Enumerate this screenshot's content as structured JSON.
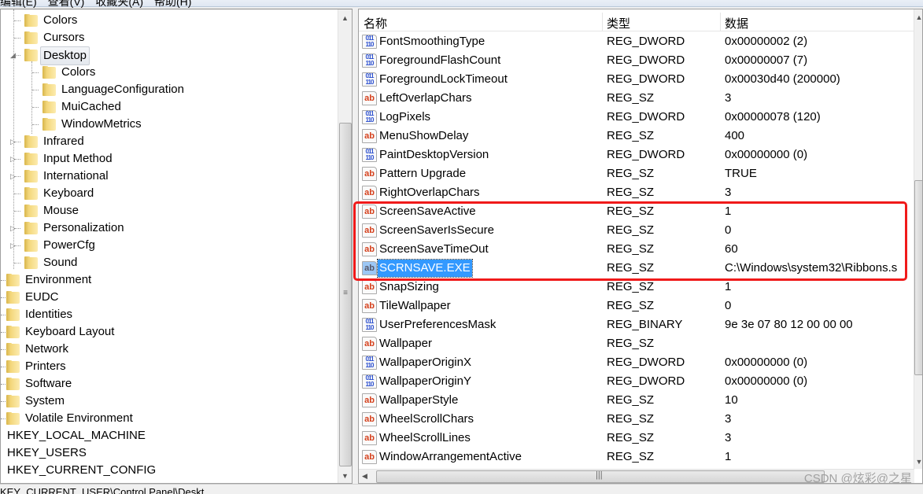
{
  "menu": [
    "编辑(E)",
    "查看(V)",
    "收藏夹(A)",
    "帮助(H)"
  ],
  "tree": [
    {
      "label": "Colors",
      "level": 1,
      "expander": "none"
    },
    {
      "label": "Cursors",
      "level": 1,
      "expander": "none"
    },
    {
      "label": "Desktop",
      "level": 1,
      "expander": "expanded",
      "selected": true
    },
    {
      "label": "Colors",
      "level": 2,
      "expander": "none"
    },
    {
      "label": "LanguageConfiguration",
      "level": 2,
      "expander": "none"
    },
    {
      "label": "MuiCached",
      "level": 2,
      "expander": "none"
    },
    {
      "label": "WindowMetrics",
      "level": 2,
      "expander": "none"
    },
    {
      "label": "Infrared",
      "level": 1,
      "expander": "collapsed"
    },
    {
      "label": "Input Method",
      "level": 1,
      "expander": "collapsed"
    },
    {
      "label": "International",
      "level": 1,
      "expander": "collapsed"
    },
    {
      "label": "Keyboard",
      "level": 1,
      "expander": "none"
    },
    {
      "label": "Mouse",
      "level": 1,
      "expander": "none"
    },
    {
      "label": "Personalization",
      "level": 1,
      "expander": "collapsed"
    },
    {
      "label": "PowerCfg",
      "level": 1,
      "expander": "collapsed"
    },
    {
      "label": "Sound",
      "level": 1,
      "expander": "none"
    },
    {
      "label": "Environment",
      "level": 0,
      "expander": "none"
    },
    {
      "label": "EUDC",
      "level": 0,
      "expander": "none"
    },
    {
      "label": "Identities",
      "level": 0,
      "expander": "none"
    },
    {
      "label": "Keyboard Layout",
      "level": 0,
      "expander": "none"
    },
    {
      "label": "Network",
      "level": 0,
      "expander": "none"
    },
    {
      "label": "Printers",
      "level": 0,
      "expander": "none"
    },
    {
      "label": "Software",
      "level": 0,
      "expander": "none"
    },
    {
      "label": "System",
      "level": 0,
      "expander": "none"
    },
    {
      "label": "Volatile Environment",
      "level": 0,
      "expander": "none"
    },
    {
      "label": "HKEY_LOCAL_MACHINE",
      "level": -1,
      "expander": "none"
    },
    {
      "label": "HKEY_USERS",
      "level": -1,
      "expander": "none"
    },
    {
      "label": "HKEY_CURRENT_CONFIG",
      "level": -1,
      "expander": "none"
    }
  ],
  "columns": {
    "name": "名称",
    "type": "类型",
    "data": "数据"
  },
  "values": [
    {
      "name": "FontSmoothingType",
      "type": "REG_DWORD",
      "data": "0x00000002 (2)",
      "icon": "binary-value-icon"
    },
    {
      "name": "ForegroundFlashCount",
      "type": "REG_DWORD",
      "data": "0x00000007 (7)",
      "icon": "binary-value-icon"
    },
    {
      "name": "ForegroundLockTimeout",
      "type": "REG_DWORD",
      "data": "0x00030d40 (200000)",
      "icon": "binary-value-icon"
    },
    {
      "name": "LeftOverlapChars",
      "type": "REG_SZ",
      "data": "3",
      "icon": "string-value-icon"
    },
    {
      "name": "LogPixels",
      "type": "REG_DWORD",
      "data": "0x00000078 (120)",
      "icon": "binary-value-icon"
    },
    {
      "name": "MenuShowDelay",
      "type": "REG_SZ",
      "data": "400",
      "icon": "string-value-icon"
    },
    {
      "name": "PaintDesktopVersion",
      "type": "REG_DWORD",
      "data": "0x00000000 (0)",
      "icon": "binary-value-icon"
    },
    {
      "name": "Pattern Upgrade",
      "type": "REG_SZ",
      "data": "TRUE",
      "icon": "string-value-icon"
    },
    {
      "name": "RightOverlapChars",
      "type": "REG_SZ",
      "data": "3",
      "icon": "string-value-icon"
    },
    {
      "name": "ScreenSaveActive",
      "type": "REG_SZ",
      "data": "1",
      "icon": "string-value-icon"
    },
    {
      "name": "ScreenSaverIsSecure",
      "type": "REG_SZ",
      "data": "0",
      "icon": "string-value-icon"
    },
    {
      "name": "ScreenSaveTimeOut",
      "type": "REG_SZ",
      "data": "60",
      "icon": "string-value-icon"
    },
    {
      "name": "SCRNSAVE.EXE",
      "type": "REG_SZ",
      "data": "C:\\Windows\\system32\\Ribbons.s",
      "icon": "string-value-icon",
      "selected": true
    },
    {
      "name": "SnapSizing",
      "type": "REG_SZ",
      "data": "1",
      "icon": "string-value-icon"
    },
    {
      "name": "TileWallpaper",
      "type": "REG_SZ",
      "data": "0",
      "icon": "string-value-icon"
    },
    {
      "name": "UserPreferencesMask",
      "type": "REG_BINARY",
      "data": "9e 3e 07 80 12 00 00 00",
      "icon": "binary-value-icon"
    },
    {
      "name": "Wallpaper",
      "type": "REG_SZ",
      "data": "",
      "icon": "string-value-icon"
    },
    {
      "name": "WallpaperOriginX",
      "type": "REG_DWORD",
      "data": "0x00000000 (0)",
      "icon": "binary-value-icon"
    },
    {
      "name": "WallpaperOriginY",
      "type": "REG_DWORD",
      "data": "0x00000000 (0)",
      "icon": "binary-value-icon"
    },
    {
      "name": "WallpaperStyle",
      "type": "REG_SZ",
      "data": "10",
      "icon": "string-value-icon"
    },
    {
      "name": "WheelScrollChars",
      "type": "REG_SZ",
      "data": "3",
      "icon": "string-value-icon"
    },
    {
      "name": "WheelScrollLines",
      "type": "REG_SZ",
      "data": "3",
      "icon": "string-value-icon"
    },
    {
      "name": "WindowArrangementActive",
      "type": "REG_SZ",
      "data": "1",
      "icon": "string-value-icon"
    }
  ],
  "status": "KEY_CURRENT_USER\\Control Panel\\Deskt",
  "watermark": "CSDN @炫彩@之星",
  "highlight_color": "#f01a1a"
}
